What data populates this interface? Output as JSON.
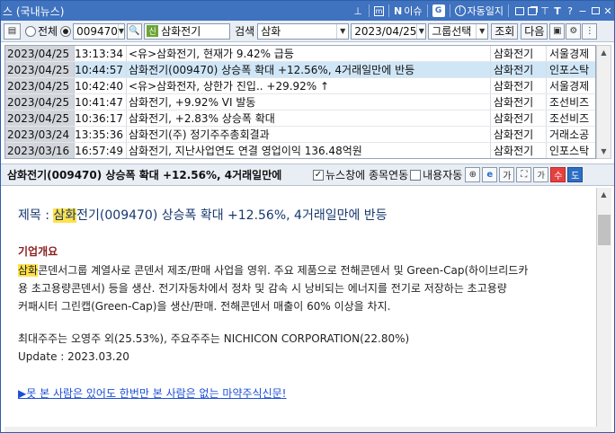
{
  "window": {
    "title": "스 (국내뉴스)",
    "title_tools": {
      "m_label": "m",
      "issue_label": "이슈",
      "autodaily_label": "자동일지",
      "font_label": "T",
      "help_label": "?"
    }
  },
  "toolbar": {
    "radio_all_label": "전체",
    "stock_code": "009470",
    "stock_name": "삼화전기",
    "sin_badge": "신",
    "search_label": "검색",
    "search_value": "삼화",
    "date_value": "2023/04/25",
    "group_select_label": "그룹선택",
    "query_button_label": "조회",
    "next_button_label": "다음"
  },
  "news": {
    "rows": [
      {
        "date": "2023/04/25",
        "time": "13:13:34",
        "title": "<유>삼화전기, 현재가 9.42% 급등",
        "stock": "삼화전기",
        "source": "서울경제"
      },
      {
        "date": "2023/04/25",
        "time": "10:44:57",
        "title": "삼화전기(009470) 상승폭 확대 +12.56%, 4거래일만에 반등",
        "stock": "삼화전기",
        "source": "인포스탁"
      },
      {
        "date": "2023/04/25",
        "time": "10:42:40",
        "title": "<유>삼화전자, 상한가 진입.. +29.92% ↑",
        "stock": "삼화전기",
        "source": "서울경제"
      },
      {
        "date": "2023/04/25",
        "time": "10:41:47",
        "title": "삼화전기, +9.92% VI 발동",
        "stock": "삼화전기",
        "source": "조선비즈"
      },
      {
        "date": "2023/04/25",
        "time": "10:36:17",
        "title": "삼화전기, +2.83% 상승폭 확대",
        "stock": "삼화전기",
        "source": "조선비즈"
      },
      {
        "date": "2023/03/24",
        "time": "13:35:36",
        "title": "삼화전기(주) 정기주주총회결과",
        "stock": "삼화전기",
        "source": "거래소공"
      },
      {
        "date": "2023/03/16",
        "time": "16:57:49",
        "title": "삼화전기, 지난사업연도 연결 영업이익 136.48억원",
        "stock": "삼화전기",
        "source": "인포스탁"
      }
    ]
  },
  "headline_bar": {
    "title": "삼화전기(009470) 상승폭 확대 +12.56%, 4거래일만에",
    "news_link_checkbox_label": "뉴스창에 종목연동",
    "news_link_checked": true,
    "content_auto_checkbox_label": "내용자동",
    "content_auto_checked": false,
    "font_up_label": "가",
    "font_down_label": "가",
    "minus_label": "수",
    "down_label": "도"
  },
  "article": {
    "title_highlight": "삼화",
    "title_prefix": "제목 : ",
    "title_rest": "전기(009470) 상승폭 확대 +12.56%, 4거래일만에 반등",
    "section_heading": "기업개요",
    "para1_highlight": "삼화",
    "para1_line1_rest": "콘덴서그룹 계열사로 콘덴서 제조/판매 사업을 영위. 주요 제품으로 전해콘덴서 및 Green-Cap(하이브리드카",
    "para1_line2": "용 초고용량콘덴서) 등을 생산. 전기자동차에서 정차 및 감속 시 낭비되는 에너지를 전기로 저장하는 초고용량",
    "para1_line3": "커패시터 그린캡(Green-Cap)을 생산/판매. 전해콘덴서 매출이 60% 이상을 차지.",
    "shareholders_line": "최대주주는 오영주 외(25.53%), 주요주주는 NICHICON CORPORATION(22.80%)",
    "update_line": "Update : 2023.03.20",
    "footer_link": "▶못 본 사람은 있어도 한번만 본 사람은 없는 마약주식신문!"
  },
  "colors": {
    "title_bar": "#3f72bf",
    "selected_row": "#cfe6f7",
    "date_column": "#d2d6dc",
    "highlight": "#ffe24a",
    "link": "#1d4fd8"
  }
}
